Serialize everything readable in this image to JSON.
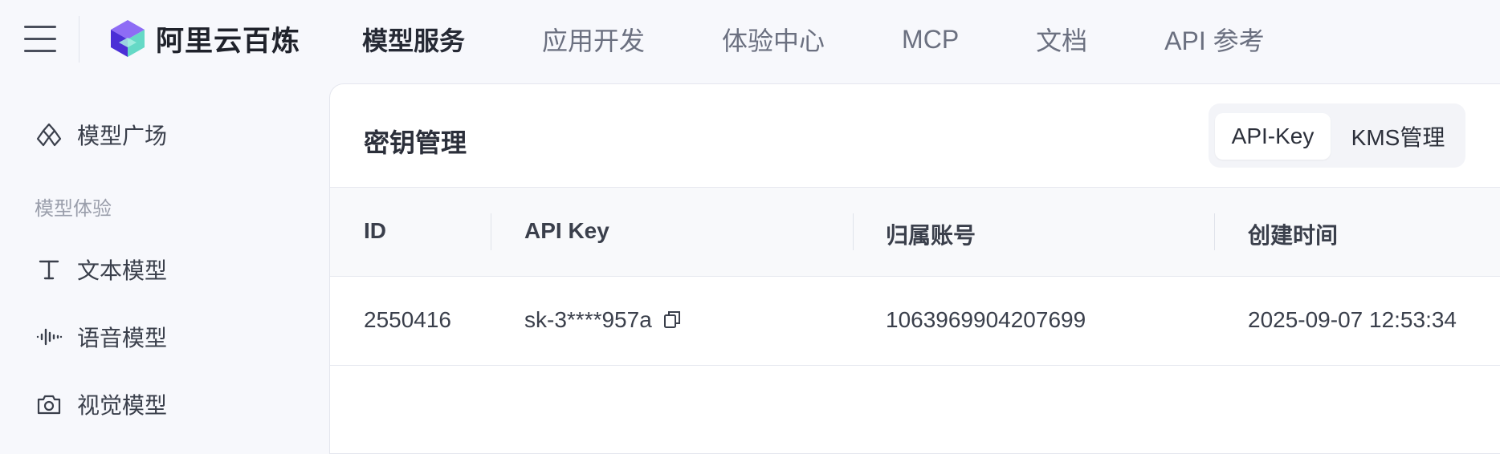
{
  "header": {
    "brand": "阿里云百炼",
    "nav": [
      {
        "label": "模型服务",
        "active": true
      },
      {
        "label": "应用开发",
        "active": false
      },
      {
        "label": "体验中心",
        "active": false
      },
      {
        "label": "MCP",
        "active": false
      },
      {
        "label": "文档",
        "active": false
      },
      {
        "label": "API 参考",
        "active": false
      }
    ]
  },
  "sidebar": {
    "items": [
      {
        "label": "模型广场",
        "icon": "model-plaza-icon"
      },
      {
        "label": "文本模型",
        "icon": "text-icon"
      },
      {
        "label": "语音模型",
        "icon": "audio-wave-icon"
      },
      {
        "label": "视觉模型",
        "icon": "camera-icon"
      }
    ],
    "group_label": "模型体验"
  },
  "main": {
    "title": "密钥管理",
    "tabs": [
      {
        "label": "API-Key",
        "active": true
      },
      {
        "label": "KMS管理",
        "active": false
      }
    ],
    "table": {
      "columns": [
        "ID",
        "API Key",
        "归属账号",
        "创建时间"
      ],
      "rows": [
        {
          "id": "2550416",
          "api_key": "sk-3****957a",
          "account": "1063969904207699",
          "created": "2025-09-07 12:53:34"
        }
      ]
    }
  },
  "colors": {
    "background": "#f7f8fc",
    "panel": "#ffffff",
    "text_primary": "#2b2f3a",
    "text_muted": "#6b7080",
    "logo_purple": "#6f4df0",
    "logo_teal": "#5fd6c8"
  }
}
